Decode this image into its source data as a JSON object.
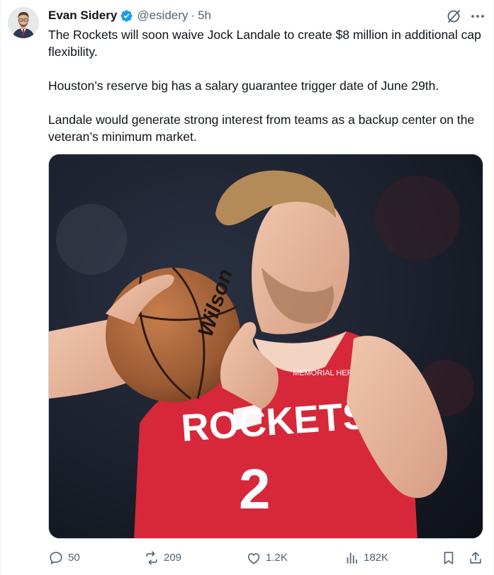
{
  "author": {
    "name": "Evan Sidery",
    "handle": "@esidery",
    "separator": "·",
    "time": "5h"
  },
  "tweet": {
    "paragraphs": [
      "The Rockets will soon waive Jock Landale to create $8 million in additional cap flexibility.",
      "Houston’s reserve big has a salary guarantee trigger date of June 29th.",
      "Landale would generate strong interest from teams as a backup center on the veteran’s minimum market."
    ]
  },
  "media": {
    "ball_brand": "Wilson",
    "jersey_team": "ROCKETS",
    "jersey_number": "2",
    "jersey_patch": "MEMORIAL HERMANN"
  },
  "actions": {
    "replies": "50",
    "reposts": "209",
    "likes": "1.2K",
    "views": "182K"
  },
  "icons": {
    "avatar": "avatar",
    "verified": "verified-badge-icon",
    "grok": "grok-icon",
    "more": "more-icon",
    "reply": "reply-icon",
    "repost": "repost-icon",
    "like": "heart-icon",
    "views": "views-icon",
    "bookmark": "bookmark-icon",
    "share": "share-icon"
  },
  "colors": {
    "text": "#0f1419",
    "secondary": "#536471",
    "verified": "#1d9bf0",
    "jersey": "#d6283a"
  }
}
